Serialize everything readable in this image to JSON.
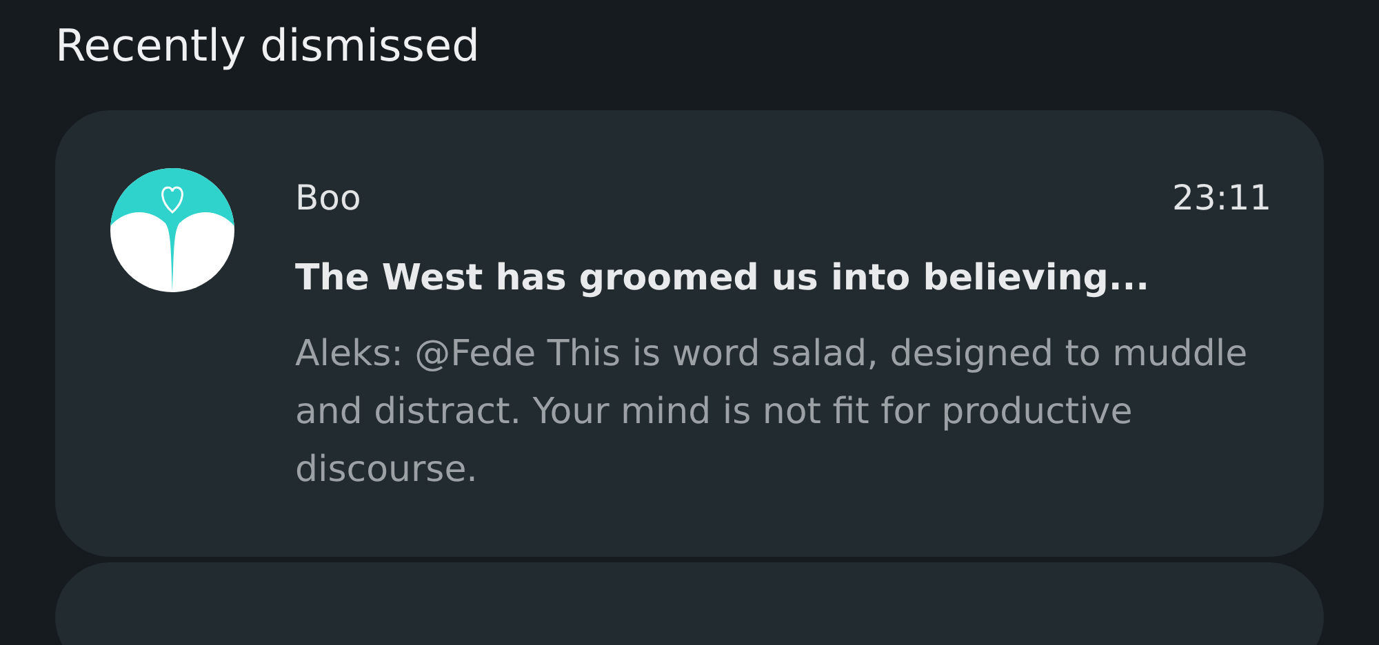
{
  "section_title": "Recently dismissed",
  "notifications": [
    {
      "app": "Boo",
      "time": "23:11",
      "title": "The West has groomed us into believing...",
      "body": "Aleks: @Fede This is word salad, designed to muddle and distract. Your mind is not fit for productive discourse."
    }
  ]
}
